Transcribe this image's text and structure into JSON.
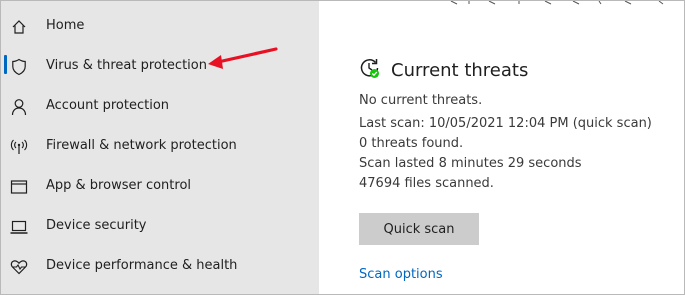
{
  "sidebar": {
    "items": [
      {
        "label": "Home",
        "icon": "home-icon"
      },
      {
        "label": "Virus & threat protection",
        "icon": "shield-icon",
        "active": true
      },
      {
        "label": "Account protection",
        "icon": "person-icon"
      },
      {
        "label": "Firewall & network protection",
        "icon": "antenna-icon"
      },
      {
        "label": "App & browser control",
        "icon": "app-window-icon"
      },
      {
        "label": "Device security",
        "icon": "laptop-icon"
      },
      {
        "label": "Device performance & health",
        "icon": "heart-icon"
      }
    ]
  },
  "main": {
    "section_title": "Current threats",
    "section_icon": "scan-refresh-check-icon",
    "status": "No current threats.",
    "last_scan": "Last scan: 10/05/2021 12:04 PM (quick scan)",
    "threats_found": "0 threats found.",
    "scan_duration": "Scan lasted 8 minutes 29 seconds",
    "files_scanned": "47694 files scanned.",
    "quick_scan_label": "Quick scan",
    "scan_options_label": "Scan options"
  },
  "colors": {
    "sidebar_bg": "#e6e6e6",
    "accent_blue": "#0067c0",
    "annotation_red": "#e81123",
    "status_green": "#16c60c",
    "button_bg": "#cccccc"
  }
}
